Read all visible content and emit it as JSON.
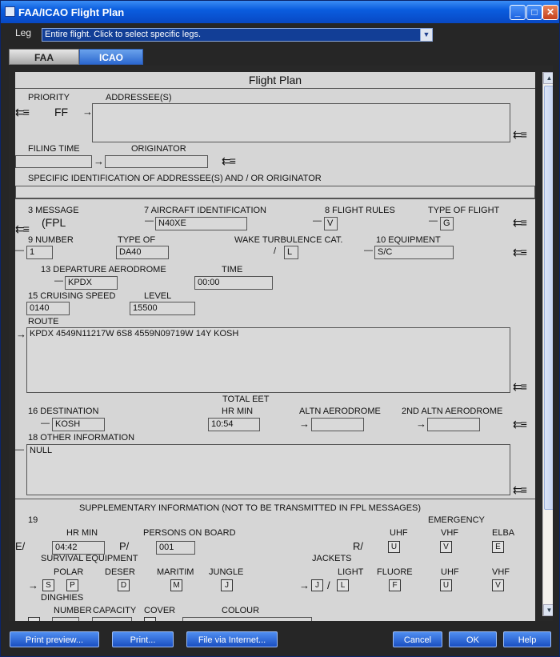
{
  "window": {
    "title": "FAA/ICAO Flight Plan",
    "controls": [
      "_",
      "□",
      "✕"
    ]
  },
  "leg": {
    "label": "Leg",
    "value": "Entire flight. Click to select specific legs."
  },
  "tabs": {
    "faa": "FAA",
    "icao": "ICAO"
  },
  "form": {
    "title": "Flight Plan",
    "priority_label": "PRIORITY",
    "priority_value": "FF",
    "addressees_label": "ADDRESSEE(S)",
    "filing_time_label": "FILING TIME",
    "originator_label": "ORIGINATOR",
    "specific_id_label": "SPECIFIC IDENTIFICATION OF ADDRESSEE(S) AND / OR ORIGINATOR",
    "message_label": "3 MESSAGE",
    "message_value": "(FPL",
    "aircraft_id_label": "7 AIRCRAFT IDENTIFICATION",
    "aircraft_id_value": "N40XE",
    "flight_rules_label": "8 FLIGHT RULES",
    "flight_rules_value": "V",
    "type_of_flight_label": "TYPE OF FLIGHT",
    "type_of_flight_value": "G",
    "number_label": "9 NUMBER",
    "number_value": "1",
    "type_of_label": "TYPE OF",
    "type_of_value": "DA40",
    "wake_label": "WAKE TURBULENCE CAT.",
    "wake_value": "L",
    "equipment_label": "10 EQUIPMENT",
    "equipment_value": "S/C",
    "departure_label": "13 DEPARTURE AERODROME",
    "departure_value": "KPDX",
    "time_label": "TIME",
    "time_value": "00:00",
    "cruising_speed_label": "15 CRUISING SPEED",
    "cruising_speed_value": "0140",
    "level_label": "LEVEL",
    "level_value": "15500",
    "route_label": "ROUTE",
    "route_value": "KPDX 4549N11217W 6S8 4559N09719W 14Y KOSH",
    "total_eet_label": "TOTAL EET",
    "destination_label": "16 DESTINATION",
    "destination_value": "KOSH",
    "hr_min_label": "HR MIN",
    "total_eet_value": "10:54",
    "altn_label": "ALTN AERODROME",
    "altn2_label": "2ND ALTN AERODROME",
    "other_info_label": "18 OTHER INFORMATION",
    "other_info_value": "NULL",
    "supp_label": "SUPPLEMENTARY INFORMATION (NOT TO BE TRANSMITTED IN FPL MESSAGES)",
    "item19_label": "19",
    "emergency_label": "EMERGENCY",
    "endurance_prefix": "E/",
    "endurance_hrmin_label": "HR MIN",
    "endurance_value": "04:42",
    "persons_prefix": "P/",
    "persons_label": "PERSONS ON BOARD",
    "persons_value": "001",
    "radio_prefix": "R/",
    "uhf_label": "UHF",
    "vhf_label": "VHF",
    "elba_label": "ELBA",
    "elba_value": "E",
    "survival_label": "SURVIVAL EQUIPMENT",
    "jackets_label": "JACKETS",
    "polar_label": "POLAR",
    "desert_label": "DESER",
    "maritime_label": "MARITIM",
    "jungle_label": "JUNGLE",
    "light_label": "LIGHT",
    "fluore_label": "FLUORE",
    "dinghies_label": "DINGHIES",
    "number2_label": "NUMBER",
    "capacity_label": "CAPACITY",
    "cover_label": "COVER",
    "colour_label": "COLOUR"
  },
  "buttons": {
    "print_preview": "Print preview...",
    "print": "Print...",
    "file_internet": "File via Internet...",
    "cancel": "Cancel",
    "ok": "OK",
    "help": "Help"
  }
}
